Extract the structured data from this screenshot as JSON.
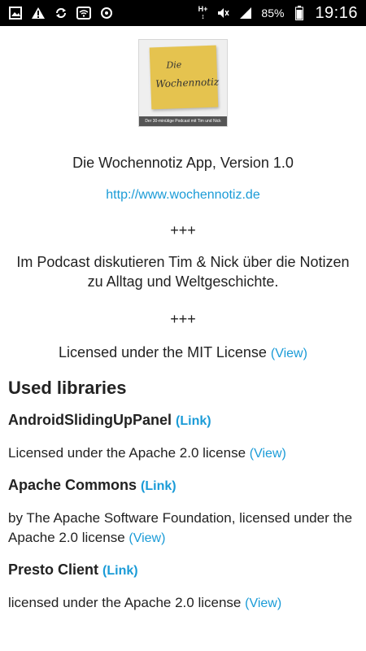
{
  "statusbar": {
    "battery": "85%",
    "time": "19:16",
    "network": "H+",
    "icons": [
      "image-icon",
      "warning-icon",
      "sync-icon",
      "wifi-icon",
      "data-icon",
      "mute-icon",
      "signal-icon",
      "battery-icon"
    ]
  },
  "about": {
    "logo_title_1": "Die",
    "logo_title_2": "Wochennotiz",
    "logo_caption": "Der 30-minütige Podcast mit Tim und Nick",
    "app_title": "Die Wochennotiz App, Version 1.0",
    "url": "http://www.wochennotiz.de",
    "separator": "+++",
    "description": "Im Podcast diskutieren Tim & Nick über die Notizen zu Alltag und Weltgeschichte.",
    "license_text": "Licensed under the MIT License",
    "view_label": "(View)"
  },
  "libraries": {
    "heading": "Used libraries",
    "link_label": "(Link)",
    "view_label": "(View)",
    "items": [
      {
        "name": "AndroidSlidingUpPanel",
        "license": "Licensed under the Apache 2.0 license"
      },
      {
        "name": "Apache Commons",
        "license": "by The Apache Software Foundation, licensed under the Apache 2.0 license"
      },
      {
        "name": "Presto Client",
        "license": "licensed under the Apache 2.0 license"
      }
    ]
  },
  "colors": {
    "link": "#1a9bd7",
    "statusbar_bg": "#000000"
  }
}
